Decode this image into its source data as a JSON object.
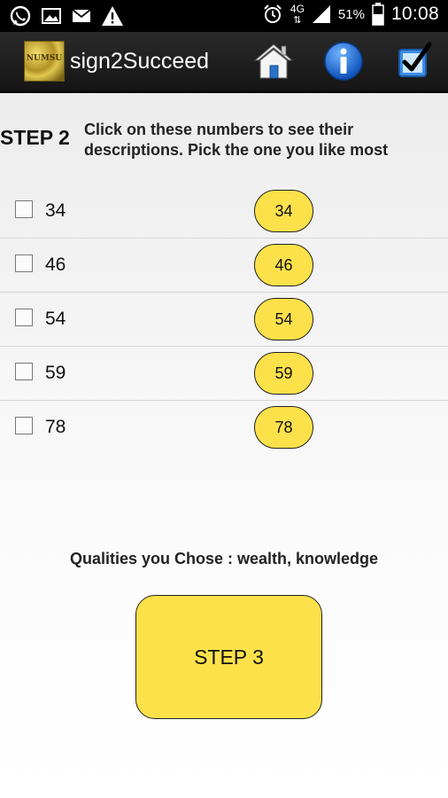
{
  "status_bar": {
    "icons_left": [
      "whatsapp-icon",
      "image-icon",
      "mail-icon",
      "warning-icon"
    ],
    "icons_right": [
      "alarm-icon",
      "network-4g-icon",
      "signal-icon",
      "battery-icon"
    ],
    "network_label": "4G",
    "battery_percent": "51%",
    "time": "10:08"
  },
  "action_bar": {
    "logo_text": "NUMSU",
    "title": "sign2Succeed",
    "actions": [
      "home-icon",
      "info-icon",
      "checklist-icon"
    ]
  },
  "step": {
    "heading": "STEP 2",
    "instructions": "Click on these numbers to see their descriptions. Pick the one you like most"
  },
  "numbers": [
    {
      "label": "34",
      "button": "34",
      "checked": false
    },
    {
      "label": "46",
      "button": "46",
      "checked": false
    },
    {
      "label": "54",
      "button": "54",
      "checked": false
    },
    {
      "label": "59",
      "button": "59",
      "checked": false
    },
    {
      "label": "78",
      "button": "78",
      "checked": false
    }
  ],
  "qualities": {
    "label": "Qualities you Chose : ",
    "value": "wealth, knowledge"
  },
  "next_button": {
    "label": "STEP 3"
  },
  "colors": {
    "accent_yellow": "#fde14a",
    "actionbar": "#1e1e1e",
    "statusbar": "#000000"
  }
}
